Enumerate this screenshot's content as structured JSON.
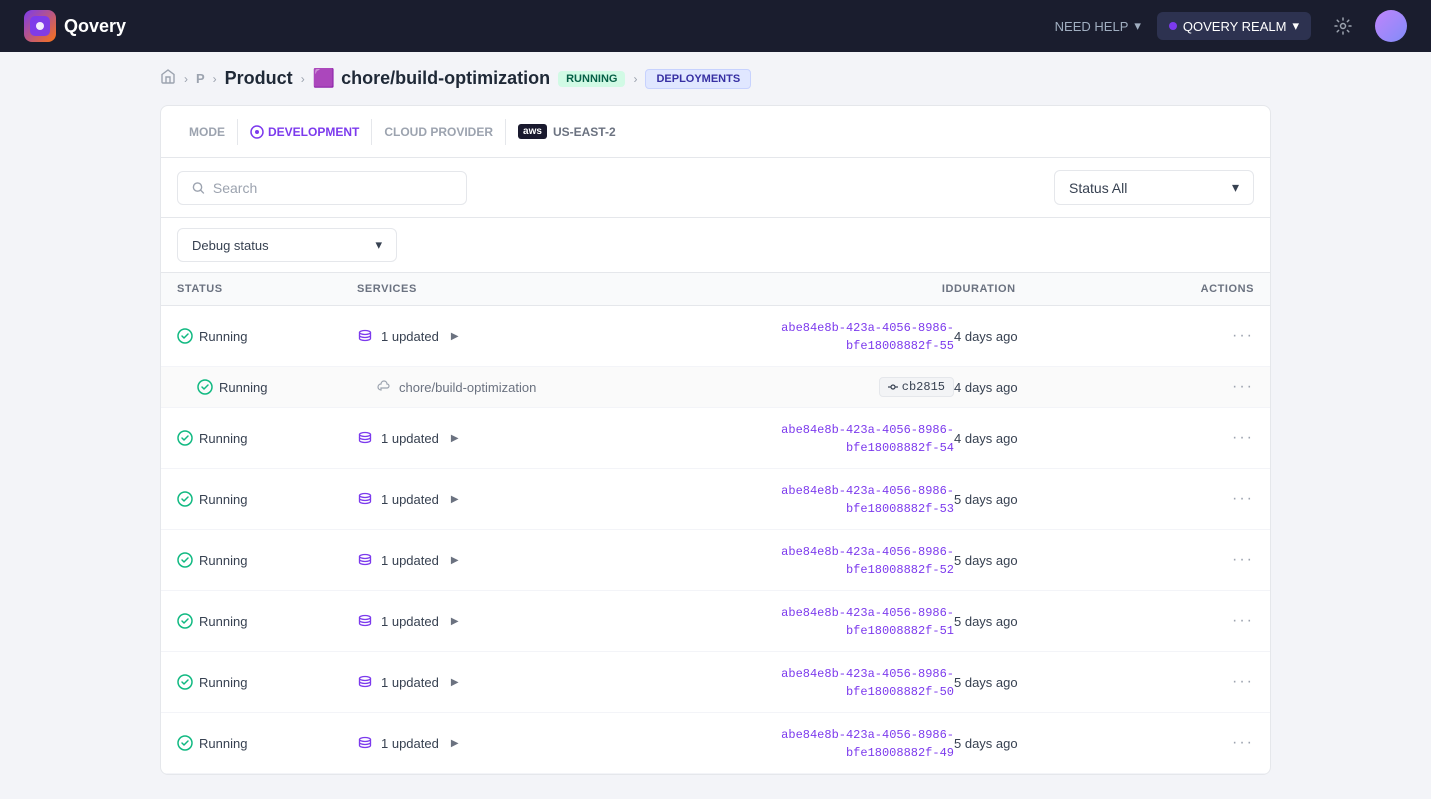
{
  "topnav": {
    "logo_letter": "Q",
    "logo_name": "Qovery",
    "need_help": "NEED HELP",
    "realm_name": "QOVERY REALM",
    "settings_icon": "⚙",
    "chevron_down": "▾"
  },
  "breadcrumb": {
    "home_icon": "🏠",
    "p_label": "P",
    "project_name": "Product",
    "service_emoji": "🟪",
    "service_name": "chore/build-optimization",
    "status": "RUNNING",
    "deployments_label": "DEPLOYMENTS"
  },
  "filters": {
    "mode_label": "MODE",
    "dev_label": "DEVELOPMENT",
    "cloud_label": "CLOUD PROVIDER",
    "region_label": "US-EAST-2"
  },
  "search": {
    "placeholder": "Search",
    "status_label": "Status All"
  },
  "debug": {
    "label": "Debug status"
  },
  "table": {
    "columns": [
      "STATUS",
      "SERVICES",
      "ID",
      "DURATION",
      "ACTIONS"
    ],
    "rows": [
      {
        "status": "Running",
        "service_label": "1 updated",
        "has_expand": true,
        "id": "abe84e8b-423a-4056-8986-bfe18008882f-55",
        "duration": "4 days ago",
        "is_sub": false,
        "is_commit": false
      },
      {
        "status": "Running",
        "service_label": "chore/build-optimization",
        "has_expand": false,
        "id": "cb2815",
        "duration": "4 days ago",
        "is_sub": true,
        "is_commit": true
      },
      {
        "status": "Running",
        "service_label": "1 updated",
        "has_expand": true,
        "id": "abe84e8b-423a-4056-8986-bfe18008882f-54",
        "duration": "4 days ago",
        "is_sub": false,
        "is_commit": false
      },
      {
        "status": "Running",
        "service_label": "1 updated",
        "has_expand": true,
        "id": "abe84e8b-423a-4056-8986-bfe18008882f-53",
        "duration": "5 days ago",
        "is_sub": false,
        "is_commit": false
      },
      {
        "status": "Running",
        "service_label": "1 updated",
        "has_expand": true,
        "id": "abe84e8b-423a-4056-8986-bfe18008882f-52",
        "duration": "5 days ago",
        "is_sub": false,
        "is_commit": false
      },
      {
        "status": "Running",
        "service_label": "1 updated",
        "has_expand": true,
        "id": "abe84e8b-423a-4056-8986-bfe18008882f-51",
        "duration": "5 days ago",
        "is_sub": false,
        "is_commit": false
      },
      {
        "status": "Running",
        "service_label": "1 updated",
        "has_expand": true,
        "id": "abe84e8b-423a-4056-8986-bfe18008882f-50",
        "duration": "5 days ago",
        "is_sub": false,
        "is_commit": false
      },
      {
        "status": "Running",
        "service_label": "1 updated",
        "has_expand": true,
        "id": "abe84e8b-423a-4056-8986-bfe18008882f-49",
        "duration": "5 days ago",
        "is_sub": false,
        "is_commit": false
      }
    ]
  }
}
